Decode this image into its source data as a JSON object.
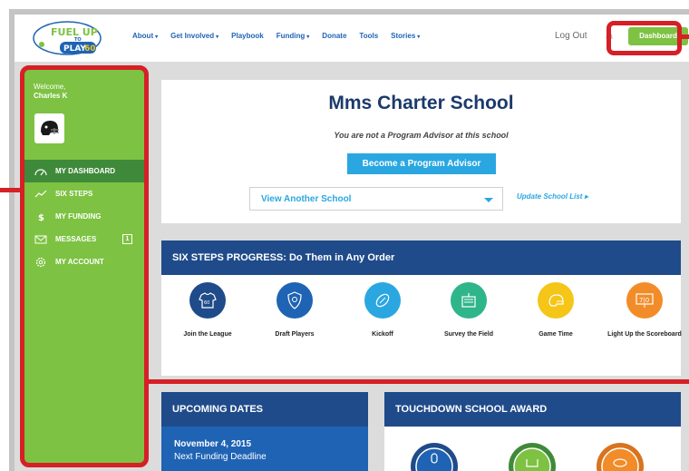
{
  "nav": {
    "items": [
      {
        "label": "About",
        "dropdown": true
      },
      {
        "label": "Get Involved",
        "dropdown": true
      },
      {
        "label": "Playbook",
        "dropdown": false
      },
      {
        "label": "Funding",
        "dropdown": true
      },
      {
        "label": "Donate",
        "dropdown": false
      },
      {
        "label": "Tools",
        "dropdown": false
      },
      {
        "label": "Stories",
        "dropdown": true
      }
    ],
    "logout_label": "Log Out",
    "dashboard_label": "Dashboard",
    "logo": {
      "line1": "FUEL UP",
      "line2": "TO",
      "line3": "PLAY",
      "line4": "60"
    }
  },
  "sidebar": {
    "welcome_label": "Welcome,",
    "user_name": "Charles K",
    "items": [
      {
        "label": "MY DASHBOARD",
        "icon": "gauge-icon",
        "active": true
      },
      {
        "label": "SIX STEPS",
        "icon": "trend-icon",
        "active": false
      },
      {
        "label": "MY FUNDING",
        "icon": "dollar-icon",
        "active": false
      },
      {
        "label": "MESSAGES",
        "icon": "envelope-icon",
        "active": false,
        "badge": "1"
      },
      {
        "label": "MY ACCOUNT",
        "icon": "gear-icon",
        "active": false
      }
    ]
  },
  "school": {
    "title": "Mms Charter School",
    "subtitle": "You are not a Program Advisor at this school",
    "advisor_button": "Become a Program Advisor",
    "select_value": "View Another School",
    "update_link": "Update School List"
  },
  "steps": {
    "header": "SIX STEPS PROGRESS: Do Them in Any Order",
    "items": [
      {
        "label": "Join the League",
        "color": "#1f4b8a",
        "icon": "jersey-icon"
      },
      {
        "label": "Draft Players",
        "color": "#1f63b4",
        "icon": "shield-icon"
      },
      {
        "label": "Kickoff",
        "color": "#2aa7e0",
        "icon": "football-icon"
      },
      {
        "label": "Survey the Field",
        "color": "#2fb58a",
        "icon": "clipboard-icon"
      },
      {
        "label": "Game Time",
        "color": "#f5c518",
        "icon": "helmet-icon"
      },
      {
        "label": "Light Up the Scoreboard",
        "color": "#f28c28",
        "icon": "scoreboard-icon"
      }
    ]
  },
  "dates": {
    "header": "UPCOMING DATES",
    "date": "November 4, 2015",
    "event": "Next Funding Deadline"
  },
  "award": {
    "header": "TOUCHDOWN SCHOOL AWARD"
  },
  "colors": {
    "green": "#7dc242",
    "dark_blue": "#1f4b8a",
    "red_highlight": "#d61f26"
  }
}
